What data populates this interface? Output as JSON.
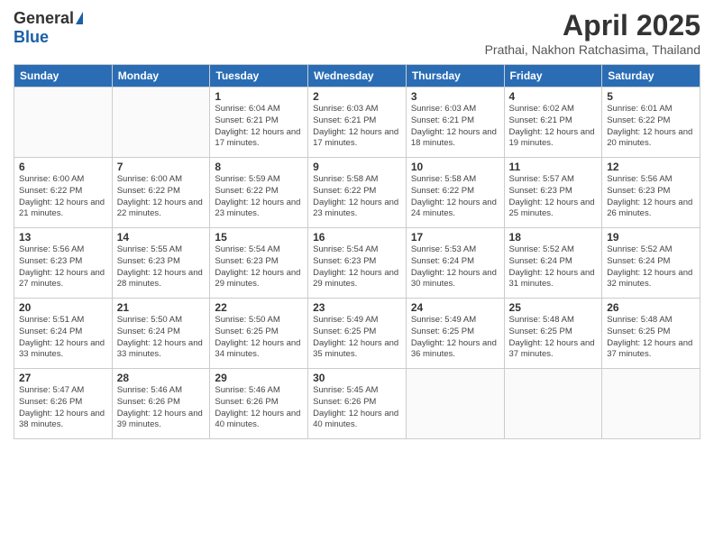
{
  "header": {
    "logo_general": "General",
    "logo_blue": "Blue",
    "title": "April 2025",
    "subtitle": "Prathai, Nakhon Ratchasima, Thailand"
  },
  "days_of_week": [
    "Sunday",
    "Monday",
    "Tuesday",
    "Wednesday",
    "Thursday",
    "Friday",
    "Saturday"
  ],
  "weeks": [
    [
      {
        "day": "",
        "info": ""
      },
      {
        "day": "",
        "info": ""
      },
      {
        "day": "1",
        "info": "Sunrise: 6:04 AM\nSunset: 6:21 PM\nDaylight: 12 hours and 17 minutes."
      },
      {
        "day": "2",
        "info": "Sunrise: 6:03 AM\nSunset: 6:21 PM\nDaylight: 12 hours and 17 minutes."
      },
      {
        "day": "3",
        "info": "Sunrise: 6:03 AM\nSunset: 6:21 PM\nDaylight: 12 hours and 18 minutes."
      },
      {
        "day": "4",
        "info": "Sunrise: 6:02 AM\nSunset: 6:21 PM\nDaylight: 12 hours and 19 minutes."
      },
      {
        "day": "5",
        "info": "Sunrise: 6:01 AM\nSunset: 6:22 PM\nDaylight: 12 hours and 20 minutes."
      }
    ],
    [
      {
        "day": "6",
        "info": "Sunrise: 6:00 AM\nSunset: 6:22 PM\nDaylight: 12 hours and 21 minutes."
      },
      {
        "day": "7",
        "info": "Sunrise: 6:00 AM\nSunset: 6:22 PM\nDaylight: 12 hours and 22 minutes."
      },
      {
        "day": "8",
        "info": "Sunrise: 5:59 AM\nSunset: 6:22 PM\nDaylight: 12 hours and 23 minutes."
      },
      {
        "day": "9",
        "info": "Sunrise: 5:58 AM\nSunset: 6:22 PM\nDaylight: 12 hours and 23 minutes."
      },
      {
        "day": "10",
        "info": "Sunrise: 5:58 AM\nSunset: 6:22 PM\nDaylight: 12 hours and 24 minutes."
      },
      {
        "day": "11",
        "info": "Sunrise: 5:57 AM\nSunset: 6:23 PM\nDaylight: 12 hours and 25 minutes."
      },
      {
        "day": "12",
        "info": "Sunrise: 5:56 AM\nSunset: 6:23 PM\nDaylight: 12 hours and 26 minutes."
      }
    ],
    [
      {
        "day": "13",
        "info": "Sunrise: 5:56 AM\nSunset: 6:23 PM\nDaylight: 12 hours and 27 minutes."
      },
      {
        "day": "14",
        "info": "Sunrise: 5:55 AM\nSunset: 6:23 PM\nDaylight: 12 hours and 28 minutes."
      },
      {
        "day": "15",
        "info": "Sunrise: 5:54 AM\nSunset: 6:23 PM\nDaylight: 12 hours and 29 minutes."
      },
      {
        "day": "16",
        "info": "Sunrise: 5:54 AM\nSunset: 6:23 PM\nDaylight: 12 hours and 29 minutes."
      },
      {
        "day": "17",
        "info": "Sunrise: 5:53 AM\nSunset: 6:24 PM\nDaylight: 12 hours and 30 minutes."
      },
      {
        "day": "18",
        "info": "Sunrise: 5:52 AM\nSunset: 6:24 PM\nDaylight: 12 hours and 31 minutes."
      },
      {
        "day": "19",
        "info": "Sunrise: 5:52 AM\nSunset: 6:24 PM\nDaylight: 12 hours and 32 minutes."
      }
    ],
    [
      {
        "day": "20",
        "info": "Sunrise: 5:51 AM\nSunset: 6:24 PM\nDaylight: 12 hours and 33 minutes."
      },
      {
        "day": "21",
        "info": "Sunrise: 5:50 AM\nSunset: 6:24 PM\nDaylight: 12 hours and 33 minutes."
      },
      {
        "day": "22",
        "info": "Sunrise: 5:50 AM\nSunset: 6:25 PM\nDaylight: 12 hours and 34 minutes."
      },
      {
        "day": "23",
        "info": "Sunrise: 5:49 AM\nSunset: 6:25 PM\nDaylight: 12 hours and 35 minutes."
      },
      {
        "day": "24",
        "info": "Sunrise: 5:49 AM\nSunset: 6:25 PM\nDaylight: 12 hours and 36 minutes."
      },
      {
        "day": "25",
        "info": "Sunrise: 5:48 AM\nSunset: 6:25 PM\nDaylight: 12 hours and 37 minutes."
      },
      {
        "day": "26",
        "info": "Sunrise: 5:48 AM\nSunset: 6:25 PM\nDaylight: 12 hours and 37 minutes."
      }
    ],
    [
      {
        "day": "27",
        "info": "Sunrise: 5:47 AM\nSunset: 6:26 PM\nDaylight: 12 hours and 38 minutes."
      },
      {
        "day": "28",
        "info": "Sunrise: 5:46 AM\nSunset: 6:26 PM\nDaylight: 12 hours and 39 minutes."
      },
      {
        "day": "29",
        "info": "Sunrise: 5:46 AM\nSunset: 6:26 PM\nDaylight: 12 hours and 40 minutes."
      },
      {
        "day": "30",
        "info": "Sunrise: 5:45 AM\nSunset: 6:26 PM\nDaylight: 12 hours and 40 minutes."
      },
      {
        "day": "",
        "info": ""
      },
      {
        "day": "",
        "info": ""
      },
      {
        "day": "",
        "info": ""
      }
    ]
  ]
}
